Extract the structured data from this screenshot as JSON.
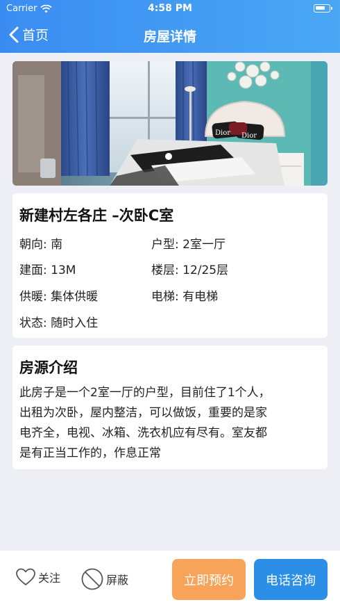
{
  "status_bar": {
    "carrier": "Carrier",
    "time": "4:58 PM"
  },
  "nav": {
    "back_label": "首页",
    "title": "房屋详情"
  },
  "photo": {
    "headboard_text_left": "Dior",
    "headboard_text_right": "Dior"
  },
  "listing": {
    "title": "新建村左各庄 –次卧C室",
    "attributes": [
      {
        "label": "朝向: 南"
      },
      {
        "label": "户型: 2室一厅"
      },
      {
        "label": "建面: 13M"
      },
      {
        "label": "楼层: 12/25层"
      },
      {
        "label": "供暖: 集体供暖"
      },
      {
        "label": "电梯: 有电梯"
      },
      {
        "label": "状态: 随时入住"
      }
    ]
  },
  "intro": {
    "title": "房源介绍",
    "lines": [
      "此房子是一个2室一厅的户型，目前住了1个人，",
      "出租为次卧，屋内整洁，可以做饭，重要的是家",
      "电齐全，电视、冰箱、洗衣机应有尽有。室友都",
      "是有正当工作的，作息正常"
    ]
  },
  "actions": {
    "follow_label": "关注",
    "block_label": "屏蔽",
    "reserve_label": "立即预约",
    "call_label": "电话咨询"
  },
  "colors": {
    "nav_gradient_start": "#3a8cf2",
    "nav_gradient_end": "#4aa7f4",
    "reserve_button": "#f7a45a",
    "call_button": "#2b8fe8",
    "background": "#eeeff4"
  }
}
